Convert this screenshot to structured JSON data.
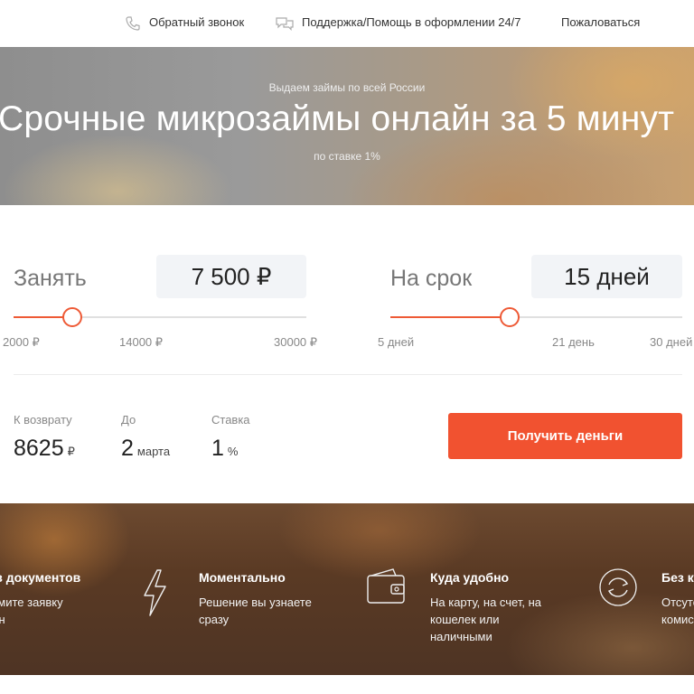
{
  "topbar": {
    "callback": "Обратный звонок",
    "support": "Поддержка/Помощь в оформлении 24/7",
    "complain": "Пожаловаться"
  },
  "hero": {
    "subtitle": "Выдаем займы по всей России",
    "title": "Срочные микрозаймы онлайн за 5 минут",
    "rate": "по ставке 1%"
  },
  "calc": {
    "amount": {
      "label": "Занять",
      "value": "7 500 ₽",
      "ticks": [
        "2000 ₽",
        "14000 ₽",
        "30000 ₽"
      ],
      "slider_fraction": 0.2
    },
    "term": {
      "label": "На срок",
      "value": "15 дней",
      "ticks": [
        "5 дней",
        "21 день",
        "30 дней"
      ],
      "slider_fraction": 0.41
    },
    "summary": {
      "return_label": "К возврату",
      "return_value": "8625",
      "return_unit": "₽",
      "until_label": "До",
      "until_value": "2",
      "until_unit": "марта",
      "rate_label": "Ставка",
      "rate_value": "1",
      "rate_unit": "%"
    },
    "cta": "Получить деньги"
  },
  "features": [
    {
      "title": "Без документов",
      "text": "Оформите заявку онлайн",
      "icon": "document-icon"
    },
    {
      "title": "Моментально",
      "text": "Решение вы узнаете сразу",
      "icon": "lightning-icon"
    },
    {
      "title": "Куда удобно",
      "text": "На карту, на счет, на кошелек или наличными",
      "icon": "wallet-icon"
    },
    {
      "title": "Без комиссий",
      "text": "Отсутствие комиссий",
      "icon": "refresh-icon"
    }
  ],
  "colors": {
    "accent": "#f15230",
    "slider": "#ee5a36"
  }
}
